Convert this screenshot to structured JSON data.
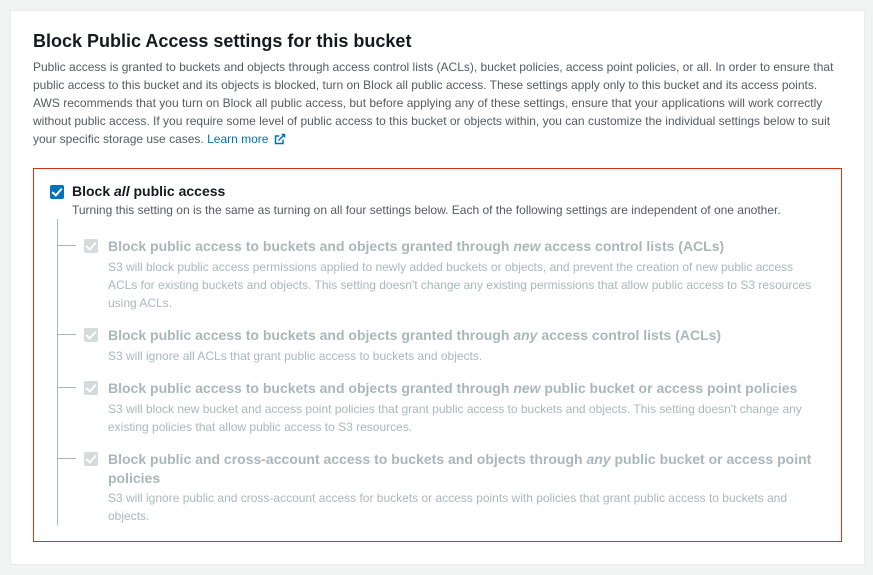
{
  "panel": {
    "title": "Block Public Access settings for this bucket",
    "description": "Public access is granted to buckets and objects through access control lists (ACLs), bucket policies, access point policies, or all. In order to ensure that public access to this bucket and its objects is blocked, turn on Block all public access. These settings apply only to this bucket and its access points. AWS recommends that you turn on Block all public access, but before applying any of these settings, ensure that your applications will work correctly without public access. If you require some level of public access to this bucket or objects within, you can customize the individual settings below to suit your specific storage use cases. ",
    "learn_more": "Learn more"
  },
  "main": {
    "title_pre": "Block ",
    "title_em": "all",
    "title_post": " public access",
    "desc": "Turning this setting on is the same as turning on all four settings below. Each of the following settings are independent of one another."
  },
  "subs": [
    {
      "title_pre": "Block public access to buckets and objects granted through ",
      "title_em": "new",
      "title_post": " access control lists (ACLs)",
      "desc": "S3 will block public access permissions applied to newly added buckets or objects, and prevent the creation of new public access ACLs for existing buckets and objects. This setting doesn't change any existing permissions that allow public access to S3 resources using ACLs."
    },
    {
      "title_pre": "Block public access to buckets and objects granted through ",
      "title_em": "any",
      "title_post": " access control lists (ACLs)",
      "desc": "S3 will ignore all ACLs that grant public access to buckets and objects."
    },
    {
      "title_pre": "Block public access to buckets and objects granted through ",
      "title_em": "new",
      "title_post": " public bucket or access point policies",
      "desc": "S3 will block new bucket and access point policies that grant public access to buckets and objects. This setting doesn't change any existing policies that allow public access to S3 resources."
    },
    {
      "title_pre": "Block public and cross-account access to buckets and objects through ",
      "title_em": "any",
      "title_post": " public bucket or access point policies",
      "desc": "S3 will ignore public and cross-account access for buckets or access points with policies that grant public access to buckets and objects."
    }
  ]
}
